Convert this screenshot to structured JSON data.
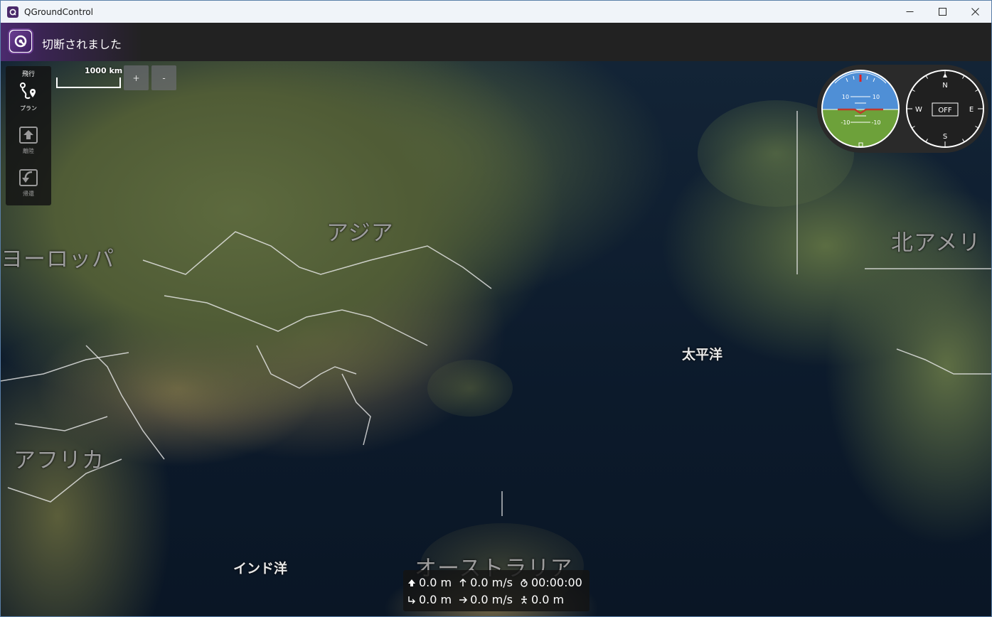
{
  "window": {
    "title": "QGroundControl",
    "minimize_icon": "minimize-icon",
    "maximize_icon": "maximize-icon",
    "close_icon": "close-icon"
  },
  "toolbar": {
    "logo_icon": "qgc-logo-icon",
    "status": "切断されました",
    "accent_color": "#4b2a6e"
  },
  "fly_tools": {
    "title": "飛行",
    "items": [
      {
        "label": "プラン",
        "icon": "plan-icon",
        "enabled": true
      },
      {
        "label": "離陸",
        "icon": "takeoff-icon",
        "enabled": false
      },
      {
        "label": "帰還",
        "icon": "return-icon",
        "enabled": false
      }
    ]
  },
  "map": {
    "scale": "1000 km",
    "zoom_in": "+",
    "zoom_out": "-",
    "labels": {
      "asia": "アジア",
      "europe": "ヨーロッパ",
      "north_america": "北アメリ",
      "africa": "アフリカ",
      "australia": "オーストラリア",
      "pacific": "太平洋",
      "indian_ocean": "インド洋"
    }
  },
  "instruments": {
    "attitude_ticks": [
      "10",
      "10",
      "-10",
      "-10"
    ],
    "compass": {
      "n": "N",
      "e": "E",
      "s": "S",
      "w": "W",
      "status": "OFF"
    },
    "sky_color": "#4f8fd6",
    "ground_color": "#6da13a"
  },
  "telemetry": {
    "row1": [
      {
        "icon": "altitude-icon",
        "value": "0.0 m"
      },
      {
        "icon": "vertical-speed-icon",
        "value": "0.0 m/s"
      },
      {
        "icon": "timer-icon",
        "value": "00:00:00"
      }
    ],
    "row2": [
      {
        "icon": "distance-icon",
        "value": "0.0 m"
      },
      {
        "icon": "ground-speed-icon",
        "value": "0.0 m/s"
      },
      {
        "icon": "home-distance-icon",
        "value": "0.0 m"
      }
    ]
  }
}
